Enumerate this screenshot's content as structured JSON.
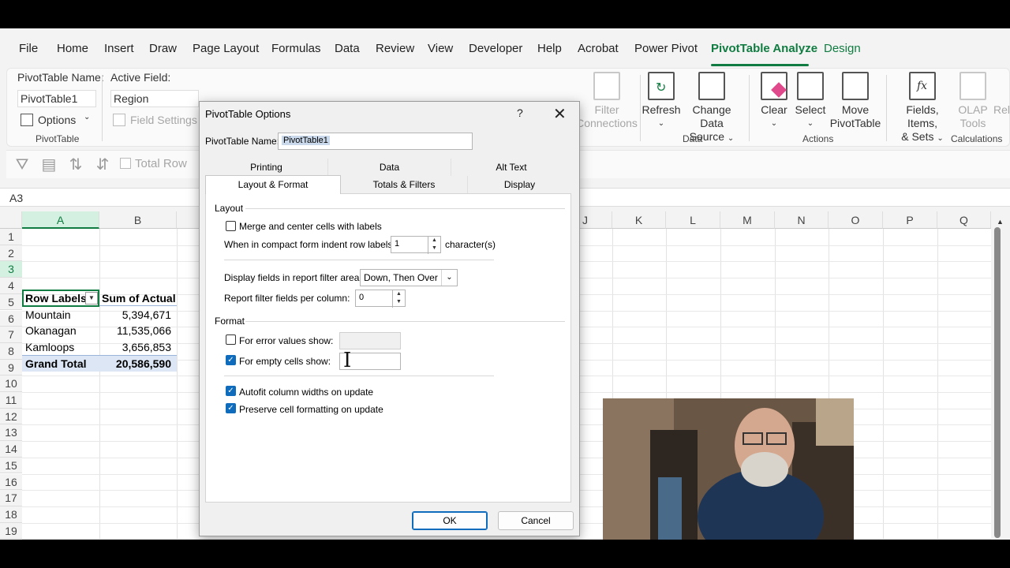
{
  "menu": {
    "tabs": [
      "File",
      "Home",
      "Insert",
      "Draw",
      "Page Layout",
      "Formulas",
      "Data",
      "Review",
      "View",
      "Developer",
      "Help",
      "Acrobat",
      "Power Pivot",
      "PivotTable Analyze",
      "Design"
    ],
    "active": "PivotTable Analyze"
  },
  "ribbon": {
    "pivottable_name_label": "PivotTable Name:",
    "pivottable_name_value": "PivotTable1",
    "active_field_label": "Active Field:",
    "active_field_value": "Region",
    "options_label": "Options",
    "field_settings_label": "Field Settings",
    "group_pivottable": "PivotTable",
    "filter_label": "Filter",
    "connections_label": "Connections",
    "refresh_label": "Refresh",
    "change_data_source_label": "Change Data",
    "change_data_source_label2": "Source",
    "group_data": "Data",
    "clear_label": "Clear",
    "select_label": "Select",
    "move_label": "Move",
    "move_label2": "PivotTable",
    "group_actions": "Actions",
    "fields_items_label": "Fields, Items,",
    "fields_items_label2": "& Sets",
    "olap_label": "OLAP",
    "olap_label2": "Tools",
    "relationships_label": "Rela",
    "group_calculations": "Calculations"
  },
  "quickbar": {
    "total_row_label": "Total Row"
  },
  "namebox": "A3",
  "grid": {
    "columns": [
      "A",
      "B",
      "J",
      "K",
      "L",
      "M",
      "N",
      "O",
      "P",
      "Q"
    ],
    "rows": [
      "1",
      "2",
      "3",
      "4",
      "5",
      "6",
      "7",
      "8",
      "9",
      "10",
      "11",
      "12",
      "13",
      "14",
      "15",
      "16",
      "17",
      "18",
      "19"
    ],
    "pivot": {
      "header_label": "Row Labels",
      "header_value": "Sum of Actual",
      "rows": [
        {
          "label": "Mountain",
          "value": "5,394,671"
        },
        {
          "label": "Okanagan",
          "value": "11,535,066"
        },
        {
          "label": "Kamloops",
          "value": "3,656,853"
        }
      ],
      "total_label": "Grand Total",
      "total_value": "20,586,590"
    }
  },
  "dialog": {
    "title": "PivotTable Options",
    "help": "?",
    "close": "✕",
    "name_label": "PivotTable Name:",
    "name_value": "PivotTable1",
    "tabs_top": [
      "Printing",
      "Data",
      "Alt Text"
    ],
    "tabs_bottom": [
      "Layout & Format",
      "Totals & Filters",
      "Display"
    ],
    "active_tab": "Layout & Format",
    "layout_section": "Layout",
    "merge_label": "Merge and center cells with labels",
    "merge_checked": false,
    "indent_label": "When in compact form indent row labels:",
    "indent_value": "1",
    "indent_unit": "character(s)",
    "display_fields_label": "Display fields in report filter area:",
    "display_fields_value": "Down, Then Over",
    "fields_per_column_label": "Report filter fields per column:",
    "fields_per_column_value": "0",
    "format_section": "Format",
    "error_values_label": "For error values show:",
    "error_values_checked": false,
    "empty_cells_label": "For empty cells show:",
    "empty_cells_checked": true,
    "autofit_label": "Autofit column widths on update",
    "autofit_checked": true,
    "preserve_label": "Preserve cell formatting on update",
    "preserve_checked": true,
    "ok_label": "OK",
    "cancel_label": "Cancel"
  },
  "colors": {
    "accent_green": "#107c41",
    "checkbox_blue": "#0f6cbd",
    "total_band": "#dce6f4"
  }
}
